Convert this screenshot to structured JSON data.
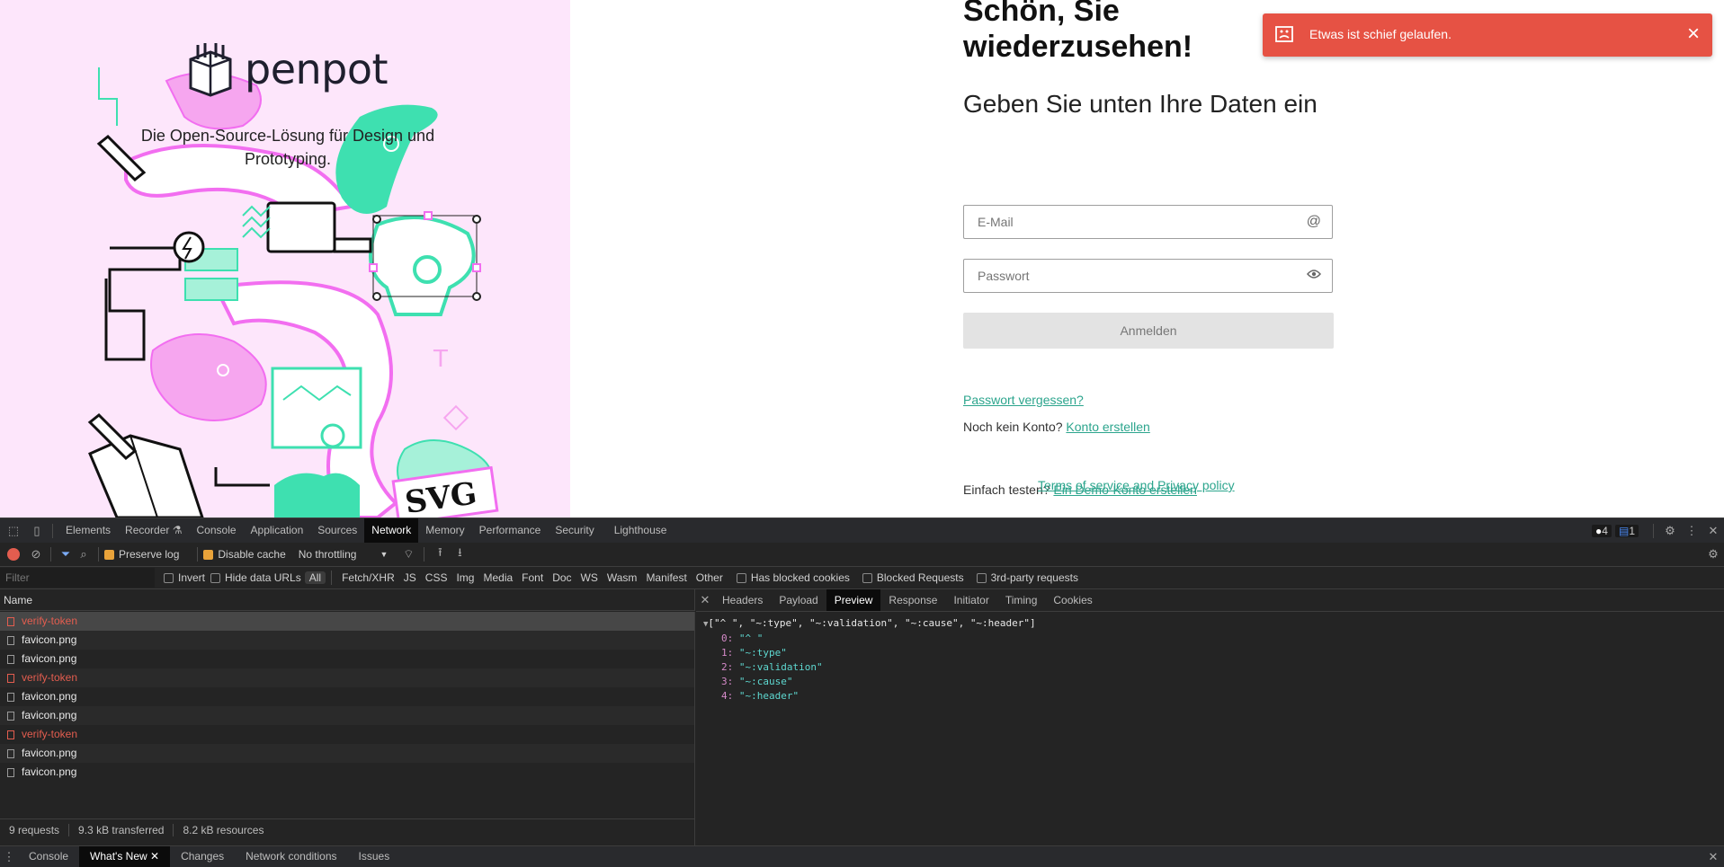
{
  "login": {
    "logo_text": "penpot",
    "tagline": "Die Open-Source-Lösung für Design und Prototyping.",
    "welcome": "Schön, Sie wiederzusehen!",
    "subtitle": "Geben Sie unten Ihre Daten ein",
    "email_placeholder": "E-Mail",
    "password_placeholder": "Passwort",
    "submit_label": "Anmelden",
    "forgot_password": "Passwort vergessen?",
    "no_account_text": "Noch kein Konto?",
    "create_account": "Konto erstellen",
    "try_text": "Einfach testen?",
    "demo_account": "Ein Demo-Konto erstellen",
    "terms_link": "Terms of service",
    "and_text": "and",
    "privacy_link": "Privacy policy"
  },
  "toast": {
    "message": "Etwas ist schief gelaufen."
  },
  "devtools": {
    "tabs": [
      "Elements",
      "Recorder",
      "Console",
      "Application",
      "Sources",
      "Network",
      "Memory",
      "Performance",
      "Security",
      "Lighthouse"
    ],
    "active_tab": "Network",
    "badge_issues": "4",
    "badge_messages": "1",
    "toolbar": {
      "preserve_log": "Preserve log",
      "disable_cache": "Disable cache",
      "throttling": "No throttling"
    },
    "filter": {
      "placeholder": "Filter",
      "invert": "Invert",
      "hide_data_urls": "Hide data URLs",
      "types": [
        "All",
        "Fetch/XHR",
        "JS",
        "CSS",
        "Img",
        "Media",
        "Font",
        "Doc",
        "WS",
        "Wasm",
        "Manifest",
        "Other"
      ],
      "has_blocked_cookies": "Has blocked cookies",
      "blocked_requests": "Blocked Requests",
      "third_party": "3rd-party requests"
    },
    "list_header": "Name",
    "requests": [
      {
        "name": "verify-token",
        "error": true
      },
      {
        "name": "favicon.png",
        "error": false
      },
      {
        "name": "favicon.png",
        "error": false
      },
      {
        "name": "verify-token",
        "error": true
      },
      {
        "name": "favicon.png",
        "error": false
      },
      {
        "name": "favicon.png",
        "error": false
      },
      {
        "name": "verify-token",
        "error": true
      },
      {
        "name": "favicon.png",
        "error": false
      },
      {
        "name": "favicon.png",
        "error": false
      }
    ],
    "status": {
      "requests": "9 requests",
      "transferred": "9.3 kB transferred",
      "resources": "8.2 kB resources"
    },
    "detail_tabs": [
      "Headers",
      "Payload",
      "Preview",
      "Response",
      "Initiator",
      "Timing",
      "Cookies"
    ],
    "detail_active": "Preview",
    "preview": {
      "summary": "[\"^ \", \"~:type\", \"~:validation\", \"~:cause\", \"~:header\"]",
      "items": [
        {
          "key": "0",
          "value": "\"^ \""
        },
        {
          "key": "1",
          "value": "\"~:type\""
        },
        {
          "key": "2",
          "value": "\"~:validation\""
        },
        {
          "key": "3",
          "value": "\"~:cause\""
        },
        {
          "key": "4",
          "value": "\"~:header\""
        }
      ]
    },
    "drawer_tabs": [
      "Console",
      "What's New",
      "Changes",
      "Network conditions",
      "Issues"
    ],
    "drawer_active": "What's New"
  },
  "colors": {
    "toast_bg": "#e65244",
    "link": "#2ca58d",
    "illustration_bg": "#fde6fb",
    "accent_pink": "#f26ef0",
    "accent_green": "#3ee0b0"
  }
}
